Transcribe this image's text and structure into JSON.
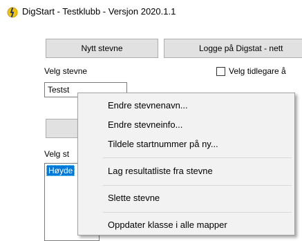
{
  "window": {
    "title": "DigStart - Testklubb - Versjon 2020.1.1",
    "icon": "app-logo-icon"
  },
  "main": {
    "new_meet_button": "Nytt stevne",
    "login_button": "Logge på Digstat - nett",
    "select_meet_label": "Velg stevne",
    "earlier_checkbox_label": "Velg tidlegare å",
    "earlier_checkbox_checked": false,
    "meet_combo_value": "Testst",
    "select_second_label": "Velg st",
    "list_selected_item": "Høyde"
  },
  "context_menu": {
    "items": [
      "Endre stevnenavn...",
      "Endre stevneinfo...",
      "Tildele startnummer på ny...",
      "Lag resultatliste fra stevne",
      "Slette stevne",
      "Oppdater klasse i alle mapper"
    ]
  },
  "colors": {
    "selection": "#0078d7",
    "button_face": "#e1e1e1",
    "menu_background": "#f2f2f2"
  }
}
